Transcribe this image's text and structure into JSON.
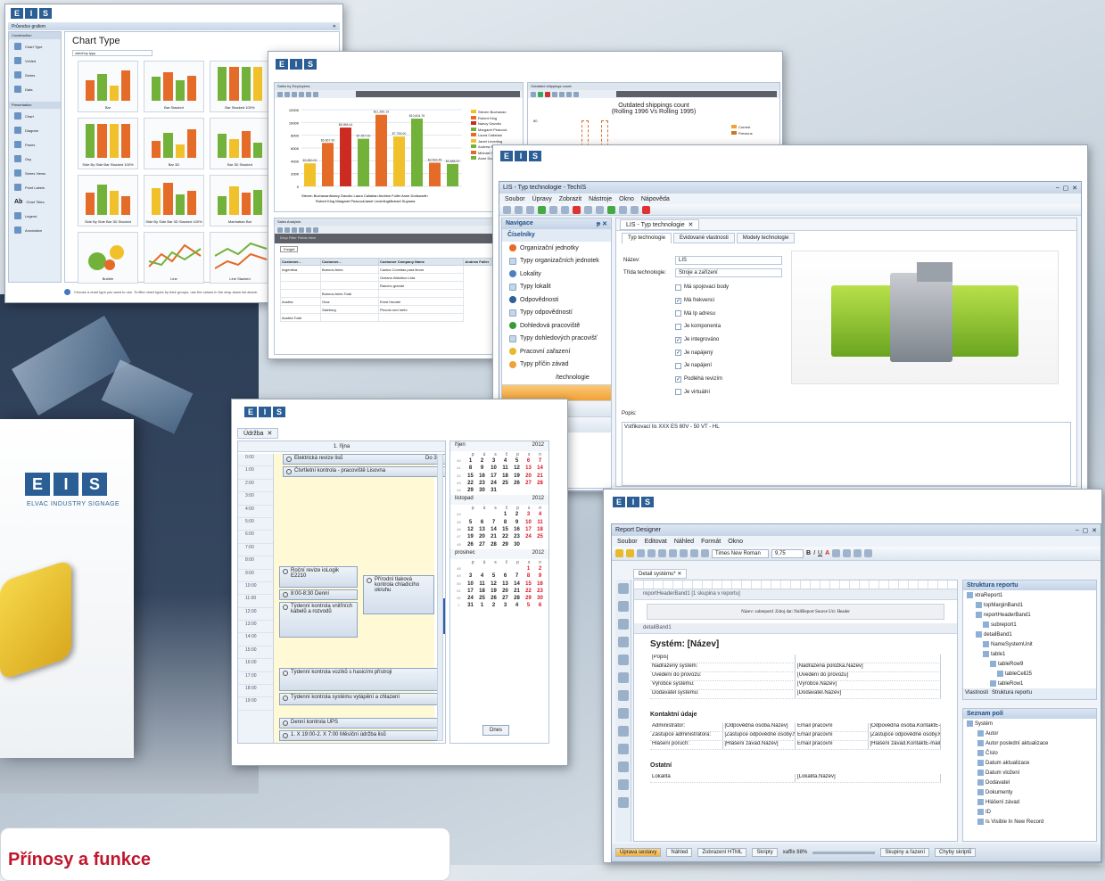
{
  "brand": {
    "logo_letters": [
      "E",
      "L",
      "I",
      "S"
    ],
    "subtitle": "ELVAC INDUSTRY SIGNAGE",
    "accent": "#2b5e95",
    "key_color": "#e8c233"
  },
  "bottom_card": {
    "heading": "Přínosy a funkce"
  },
  "chart_gallery": {
    "window_title": "Průvodce grafem",
    "title": "Chart Type",
    "filter": "všechny typy",
    "nav_sections": [
      {
        "header": "Construction",
        "items": [
          "Chart Type",
          "Vzhled",
          "Series",
          "Data"
        ]
      },
      {
        "header": "Presentation",
        "items": [
          "Chart",
          "Diagram",
          "Panes",
          "Osy",
          "Series Views",
          "Point Labels",
          "Chart Titles",
          "Legend",
          "Annotation"
        ]
      }
    ],
    "types": [
      "Bar",
      "Bar Stacked",
      "Bar Stacked 100%",
      "Side By Side Bar Stacked 100%",
      "Bar 3D",
      "Bar 3D Stacked",
      "Side By Side Bar 3D Stacked",
      "Side By Side Bar 3D Stacked 100%",
      "Manhattan Bar",
      "Bubble",
      "Line",
      "Line Stacked"
    ],
    "hint": "Choose a chart type you want to use. To filter chart types by their groups, use the values in the drop-down list above.",
    "buttons": [
      "< Previous",
      "Next >"
    ]
  },
  "sales_window": {
    "panel1": "Sales by Employees:",
    "panel2": "Outdated shippings count:",
    "chart2_title": "Outdated shippings count",
    "chart2_subtitle": "(Rolling 1996 Vs Rolling 1995)",
    "chart2_legend": [
      "Current",
      "Previous"
    ],
    "chart2_ytick": "80",
    "yticks": [
      "12000",
      "10000",
      "8000",
      "6000",
      "4000",
      "2000",
      "0"
    ],
    "legend": [
      "Steven Buchanan",
      "Robert King",
      "Nancy Davolio",
      "Margaret Peacock",
      "Laura Callahan",
      "Janet Leverling",
      "Andrew Fuller",
      "Michael Suyama",
      "Anne Dodsworth"
    ],
    "xlabels_row1": "Steven BuchananNancy Davolio  Laura Callahan  Andrew Fuller Anne Dodsworth",
    "xlabels_row2": "Robert King Margaret PeacockJanet LeverlingMichael Suyama",
    "panel3": "Sales Analysis:",
    "pivot_hint": "Drop Filter Fields Here",
    "pivot_fields": [
      "Freight",
      "Employee Full Name"
    ],
    "pivot_headers": [
      "Customer...",
      "Customer...",
      "Customer Company Name",
      "Andrew Fuller"
    ],
    "pivot_rows": [
      [
        "Argentina",
        "Buenos Aires",
        "Cactus Comidas para llevar"
      ],
      [
        "",
        "",
        "Océano Atlántico Ltda."
      ],
      [
        "",
        "",
        "Rancho grande"
      ],
      [
        "",
        "Buenos Aires Total",
        ""
      ],
      [
        "Austria",
        "Graz",
        "Ernst Handel"
      ],
      [
        "",
        "Salzburg",
        "Piccolo und mehr"
      ],
      [
        "Austria Total",
        "",
        ""
      ]
    ]
  },
  "chart_data": {
    "type": "bar",
    "title": "",
    "xlabel": "",
    "ylabel": "",
    "ylim": [
      0,
      12000
    ],
    "categories": [
      "Steven Buchanan",
      "Robert King",
      "Nancy Davolio",
      "Margaret Peacock",
      "Laura Callahan",
      "Janet Leverling",
      "Andrew Fuller",
      "Michael Suyama",
      "Anne Dodsworth"
    ],
    "values": [
      3600,
      6800,
      9200,
      7450,
      11200,
      7800,
      10600,
      3700,
      3500
    ],
    "data_labels": [
      "$3,550.00",
      "$6,667.90",
      "$8,958.44",
      "$7,457.00",
      "$11,360.19",
      "$7,755.00",
      "$10,604.76",
      "$3,593.45",
      "$3,488.20"
    ],
    "colors": [
      "#f0c12b",
      "#e46b28",
      "#cc2b22",
      "#73b23a",
      "#e46b28",
      "#f0c12b",
      "#73b23a",
      "#e46b28",
      "#73b23a"
    ]
  },
  "techis": {
    "window_title": "LIS - Typ technologie - TechIS",
    "menu": [
      "Soubor",
      "Úpravy",
      "Zobrazit",
      "Nástroje",
      "Okno",
      "Nápověda"
    ],
    "nav_title": "Navigace",
    "nav_section": "Číselníky",
    "nav_items": [
      "Organizační jednotky",
      "Typy organizačních jednotek",
      "Lokality",
      "Typy lokalit",
      "Odpovědnosti",
      "Typy odpovědností",
      "Dohledová pracoviště",
      "Typy dohledových pracovišť",
      "Pracovní zařazení",
      "Typy příčin závad"
    ],
    "nav_more": [
      "/technologie",
      "ka",
      "nce",
      "IS",
      "rver: srv-soli"
    ],
    "doc_tab": "LIS - Typ technologie",
    "subtabs": [
      "Typ technologie",
      "Evidované vlastnosti",
      "Modely technologie"
    ],
    "name_label": "Název:",
    "name_value": "LIS",
    "class_label": "Třída technologie:",
    "class_value": "Stroje a zařízení",
    "checks": [
      {
        "label": "Má spojovací body",
        "on": false
      },
      {
        "label": "Má frekvenci",
        "on": true
      },
      {
        "label": "Má Ip adresu",
        "on": false
      },
      {
        "label": "Je komponenta",
        "on": false
      },
      {
        "label": "Je integrováno",
        "on": true
      },
      {
        "label": "Je napájený",
        "on": true
      },
      {
        "label": "Je napájení",
        "on": false
      },
      {
        "label": "Podléhá revizím",
        "on": true
      },
      {
        "label": "Je virtuální",
        "on": false
      }
    ],
    "desc_label": "Popis:",
    "desc_value": "Vstřikovací lis XXX ES 80V - 50 VT - HL"
  },
  "calendar": {
    "tab": "Údržba",
    "day_header": "1. října",
    "allday": [
      {
        "text": "Elektrická revize lisů",
        "right": "Do 3. X"
      },
      {
        "text": "Čtvrtletní kontrola - pracoviště Lisovna",
        "right": ""
      }
    ],
    "times": [
      "0:00",
      "1:00",
      "2:00",
      "3:00",
      "4:00",
      "5:00",
      "6:00",
      "7:00",
      "8:00",
      "9:00",
      "10:00",
      "11:00",
      "12:00",
      "13:00",
      "14:00",
      "15:00",
      "16:00",
      "17:00",
      "18:00",
      "19:00"
    ],
    "events": [
      {
        "text": "Roční revize ioLogik E2210"
      },
      {
        "text": "Přírodní tlaková kontrola chladicího okruhu"
      },
      {
        "text": "8:00-8:30 Denní"
      },
      {
        "text": "Týdenní kontrola vnitřních kabelů a rozvodů"
      },
      {
        "text": "Týdenní kontrola vozíků s hasicími přístroji"
      },
      {
        "text": "Týdenní kontrola systému vytápění a chlazení"
      },
      {
        "text": "Denní kontrola UPS"
      },
      {
        "text": "1. X 19:00-2. X 7:00 Měsíční údržba lisů"
      }
    ],
    "dow": [
      "p",
      "ú",
      "s",
      "č",
      "p",
      "s",
      "n"
    ],
    "months": [
      {
        "name": "říjen",
        "year": "2012",
        "weeks": [
          [
            "40",
            "1",
            "2",
            "3",
            "4",
            "5",
            "6",
            "7"
          ],
          [
            "41",
            "8",
            "9",
            "10",
            "11",
            "12",
            "13",
            "14"
          ],
          [
            "42",
            "15",
            "16",
            "17",
            "18",
            "19",
            "20",
            "21"
          ],
          [
            "43",
            "22",
            "23",
            "24",
            "25",
            "26",
            "27",
            "28"
          ],
          [
            "44",
            "29",
            "30",
            "31",
            "",
            "",
            "",
            ""
          ]
        ]
      },
      {
        "name": "listopad",
        "year": "2012",
        "weeks": [
          [
            "44",
            "",
            "",
            "",
            "1",
            "2",
            "3",
            "4"
          ],
          [
            "45",
            "5",
            "6",
            "7",
            "8",
            "9",
            "10",
            "11"
          ],
          [
            "46",
            "12",
            "13",
            "14",
            "15",
            "16",
            "17",
            "18"
          ],
          [
            "47",
            "19",
            "20",
            "21",
            "22",
            "23",
            "24",
            "25"
          ],
          [
            "48",
            "26",
            "27",
            "28",
            "29",
            "30",
            "",
            ""
          ]
        ]
      },
      {
        "name": "prosinec",
        "year": "2012",
        "weeks": [
          [
            "48",
            "",
            "",
            "",
            "",
            "",
            "1",
            "2"
          ],
          [
            "49",
            "3",
            "4",
            "5",
            "6",
            "7",
            "8",
            "9"
          ],
          [
            "50",
            "10",
            "11",
            "12",
            "13",
            "14",
            "15",
            "16"
          ],
          [
            "51",
            "17",
            "18",
            "19",
            "20",
            "21",
            "22",
            "23"
          ],
          [
            "52",
            "24",
            "25",
            "26",
            "27",
            "28",
            "29",
            "30"
          ],
          [
            "1",
            "31",
            "1",
            "2",
            "3",
            "4",
            "5",
            "6"
          ]
        ]
      }
    ],
    "today_button": "Dnes"
  },
  "report": {
    "window_title": "Report Designer",
    "menu": [
      "Soubor",
      "Editovat",
      "Náhled",
      "Formát",
      "Okno"
    ],
    "font": "Times New Roman",
    "size": "9,75",
    "fmt": [
      "B",
      "I",
      "U"
    ],
    "doc_tab": "Detail systému*",
    "band1": "reportHeaderBand1 [1 skupina v reportu]",
    "subreport": "Název: subreport1 Zdroj dat: NullReport Source Uri: Header",
    "band2": "detailBand1",
    "heading": "Systém:    [Název]",
    "rows1": [
      [
        "[Popis]",
        ""
      ],
      [
        "Nadřazený systém:",
        "[Nadřazená položka.Název]"
      ],
      [
        "Uvedení do provozu:",
        "[Uvedení do provozu]"
      ],
      [
        "Výrobce systému:",
        "[Výrobce.Název]"
      ],
      [
        "Dodavatel systému:",
        "[Dodavatel.Název]"
      ]
    ],
    "sec2": "Kontaktní údaje",
    "rows2": [
      [
        "Administrátor:",
        "[Odpovědná osoba.Název]",
        "Email pracovní",
        "[Odpovědná osoba.KontaktE-mail]"
      ],
      [
        "Zástupce administrátora:",
        "[Zástupce odpovědné osoby.Název]",
        "Email pracovní",
        "[Zástupce odpovědné osoby.Ko]"
      ],
      [
        "Hlášení poruch:",
        "[Hlášení závad.Název]",
        "Email pracovní",
        "[Hlášení závad.KontaktE-mail]"
      ]
    ],
    "sec3": "Ostatní",
    "rows3": [
      [
        "Lokalita",
        "[Lokalita.Název]"
      ]
    ],
    "tree_title": "Struktura reportu",
    "tree": [
      "xtraReport1",
      "topMarginBand1",
      "reportHeaderBand1",
      "subreport1",
      "detailBand1",
      "NameSystemUnit",
      "table1",
      "tableRow9",
      "tableCell25",
      "tableRow1"
    ],
    "tree_tabs": [
      "Vlastnosti",
      "Struktura reportu"
    ],
    "fields_title": "Seznam polí",
    "fields": [
      "Systém",
      "Autor",
      "Autor poslední aktualizace",
      "Číslo",
      "Datum aktualizace",
      "Datum vložení",
      "Dodavatel",
      "Dokumenty",
      "Hlášení závad",
      "ID",
      "Is Visible In New Record"
    ],
    "status_tabs": [
      "Úprava sestavy",
      "Náhled",
      "Zobrazení HTML",
      "Skripty"
    ],
    "zoom": "xaffix 88%",
    "bottom_tabs": [
      "Skupiny a řazení",
      "Chyby skriptů"
    ]
  }
}
